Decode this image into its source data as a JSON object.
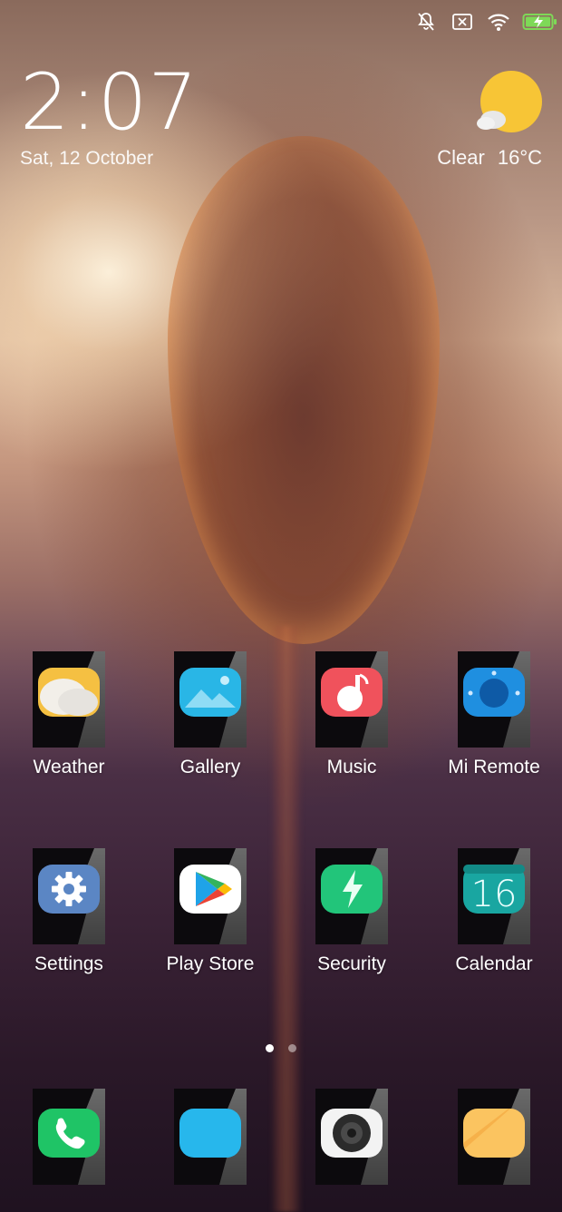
{
  "status_bar": {
    "icons": [
      "mute-icon",
      "sim-off-icon",
      "wifi-icon",
      "battery-charging-icon"
    ],
    "battery_color": "#7ed957"
  },
  "clock": {
    "time": "2:07",
    "date": "Sat, 12 October"
  },
  "weather": {
    "condition": "Clear",
    "temperature": "16°C",
    "sun_color": "#f7c536"
  },
  "apps_row1": [
    {
      "label": "Weather",
      "icon": "weather-icon"
    },
    {
      "label": "Gallery",
      "icon": "gallery-icon"
    },
    {
      "label": "Music",
      "icon": "music-icon"
    },
    {
      "label": "Mi Remote",
      "icon": "remote-icon"
    }
  ],
  "apps_row2": [
    {
      "label": "Settings",
      "icon": "gear-icon"
    },
    {
      "label": "Play Store",
      "icon": "play-store-icon"
    },
    {
      "label": "Security",
      "icon": "security-icon"
    },
    {
      "label": "Calendar",
      "icon": "calendar-icon",
      "day": "16"
    }
  ],
  "dock": [
    {
      "icon": "phone-icon"
    },
    {
      "icon": "messages-icon"
    },
    {
      "icon": "camera-icon"
    },
    {
      "icon": "notes-icon"
    }
  ],
  "pages": {
    "count": 2,
    "active": 1
  }
}
